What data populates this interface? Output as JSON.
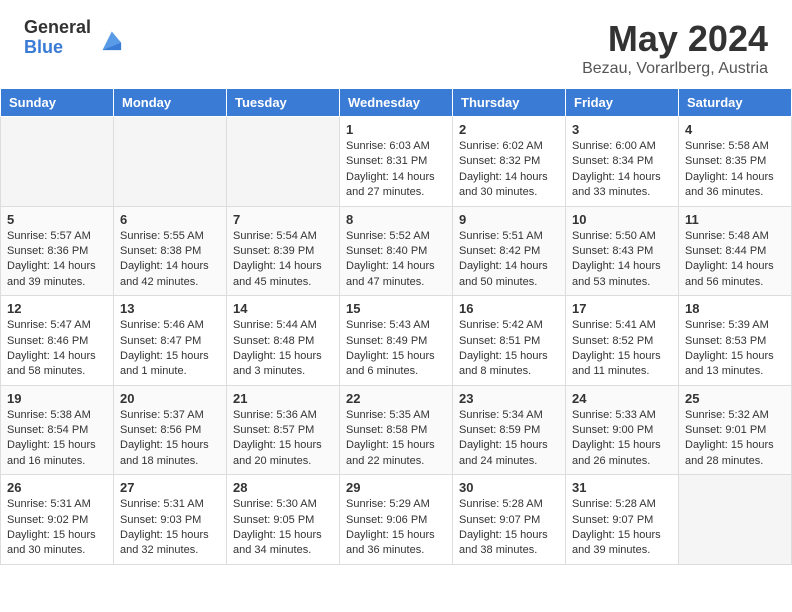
{
  "header": {
    "logo_general": "General",
    "logo_blue": "Blue",
    "month_title": "May 2024",
    "location": "Bezau, Vorarlberg, Austria"
  },
  "weekdays": [
    "Sunday",
    "Monday",
    "Tuesday",
    "Wednesday",
    "Thursday",
    "Friday",
    "Saturday"
  ],
  "weeks": [
    [
      {
        "day": "",
        "info": ""
      },
      {
        "day": "",
        "info": ""
      },
      {
        "day": "",
        "info": ""
      },
      {
        "day": "1",
        "info": "Sunrise: 6:03 AM\nSunset: 8:31 PM\nDaylight: 14 hours\nand 27 minutes."
      },
      {
        "day": "2",
        "info": "Sunrise: 6:02 AM\nSunset: 8:32 PM\nDaylight: 14 hours\nand 30 minutes."
      },
      {
        "day": "3",
        "info": "Sunrise: 6:00 AM\nSunset: 8:34 PM\nDaylight: 14 hours\nand 33 minutes."
      },
      {
        "day": "4",
        "info": "Sunrise: 5:58 AM\nSunset: 8:35 PM\nDaylight: 14 hours\nand 36 minutes."
      }
    ],
    [
      {
        "day": "5",
        "info": "Sunrise: 5:57 AM\nSunset: 8:36 PM\nDaylight: 14 hours\nand 39 minutes."
      },
      {
        "day": "6",
        "info": "Sunrise: 5:55 AM\nSunset: 8:38 PM\nDaylight: 14 hours\nand 42 minutes."
      },
      {
        "day": "7",
        "info": "Sunrise: 5:54 AM\nSunset: 8:39 PM\nDaylight: 14 hours\nand 45 minutes."
      },
      {
        "day": "8",
        "info": "Sunrise: 5:52 AM\nSunset: 8:40 PM\nDaylight: 14 hours\nand 47 minutes."
      },
      {
        "day": "9",
        "info": "Sunrise: 5:51 AM\nSunset: 8:42 PM\nDaylight: 14 hours\nand 50 minutes."
      },
      {
        "day": "10",
        "info": "Sunrise: 5:50 AM\nSunset: 8:43 PM\nDaylight: 14 hours\nand 53 minutes."
      },
      {
        "day": "11",
        "info": "Sunrise: 5:48 AM\nSunset: 8:44 PM\nDaylight: 14 hours\nand 56 minutes."
      }
    ],
    [
      {
        "day": "12",
        "info": "Sunrise: 5:47 AM\nSunset: 8:46 PM\nDaylight: 14 hours\nand 58 minutes."
      },
      {
        "day": "13",
        "info": "Sunrise: 5:46 AM\nSunset: 8:47 PM\nDaylight: 15 hours\nand 1 minute."
      },
      {
        "day": "14",
        "info": "Sunrise: 5:44 AM\nSunset: 8:48 PM\nDaylight: 15 hours\nand 3 minutes."
      },
      {
        "day": "15",
        "info": "Sunrise: 5:43 AM\nSunset: 8:49 PM\nDaylight: 15 hours\nand 6 minutes."
      },
      {
        "day": "16",
        "info": "Sunrise: 5:42 AM\nSunset: 8:51 PM\nDaylight: 15 hours\nand 8 minutes."
      },
      {
        "day": "17",
        "info": "Sunrise: 5:41 AM\nSunset: 8:52 PM\nDaylight: 15 hours\nand 11 minutes."
      },
      {
        "day": "18",
        "info": "Sunrise: 5:39 AM\nSunset: 8:53 PM\nDaylight: 15 hours\nand 13 minutes."
      }
    ],
    [
      {
        "day": "19",
        "info": "Sunrise: 5:38 AM\nSunset: 8:54 PM\nDaylight: 15 hours\nand 16 minutes."
      },
      {
        "day": "20",
        "info": "Sunrise: 5:37 AM\nSunset: 8:56 PM\nDaylight: 15 hours\nand 18 minutes."
      },
      {
        "day": "21",
        "info": "Sunrise: 5:36 AM\nSunset: 8:57 PM\nDaylight: 15 hours\nand 20 minutes."
      },
      {
        "day": "22",
        "info": "Sunrise: 5:35 AM\nSunset: 8:58 PM\nDaylight: 15 hours\nand 22 minutes."
      },
      {
        "day": "23",
        "info": "Sunrise: 5:34 AM\nSunset: 8:59 PM\nDaylight: 15 hours\nand 24 minutes."
      },
      {
        "day": "24",
        "info": "Sunrise: 5:33 AM\nSunset: 9:00 PM\nDaylight: 15 hours\nand 26 minutes."
      },
      {
        "day": "25",
        "info": "Sunrise: 5:32 AM\nSunset: 9:01 PM\nDaylight: 15 hours\nand 28 minutes."
      }
    ],
    [
      {
        "day": "26",
        "info": "Sunrise: 5:31 AM\nSunset: 9:02 PM\nDaylight: 15 hours\nand 30 minutes."
      },
      {
        "day": "27",
        "info": "Sunrise: 5:31 AM\nSunset: 9:03 PM\nDaylight: 15 hours\nand 32 minutes."
      },
      {
        "day": "28",
        "info": "Sunrise: 5:30 AM\nSunset: 9:05 PM\nDaylight: 15 hours\nand 34 minutes."
      },
      {
        "day": "29",
        "info": "Sunrise: 5:29 AM\nSunset: 9:06 PM\nDaylight: 15 hours\nand 36 minutes."
      },
      {
        "day": "30",
        "info": "Sunrise: 5:28 AM\nSunset: 9:07 PM\nDaylight: 15 hours\nand 38 minutes."
      },
      {
        "day": "31",
        "info": "Sunrise: 5:28 AM\nSunset: 9:07 PM\nDaylight: 15 hours\nand 39 minutes."
      },
      {
        "day": "",
        "info": ""
      }
    ]
  ]
}
